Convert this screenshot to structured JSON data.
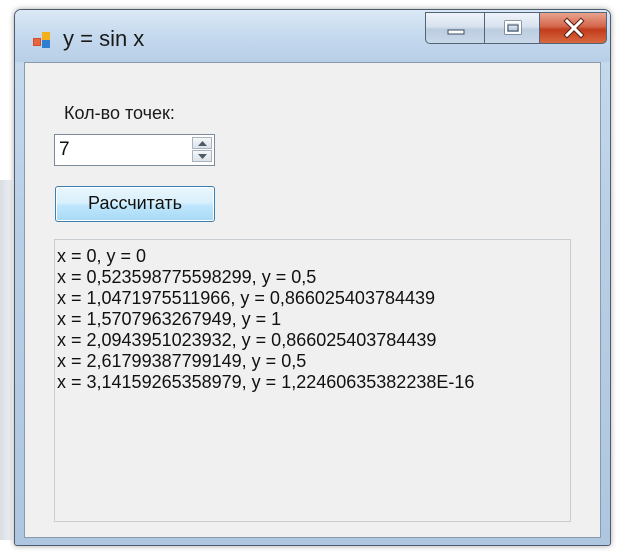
{
  "window": {
    "title": "y = sin x"
  },
  "form": {
    "count_label": "Кол-во точек:",
    "count_value": "7",
    "calculate_label": "Рассчитать"
  },
  "output": {
    "lines": [
      "x = 0, y = 0",
      "x = 0,523598775598299, y = 0,5",
      "x = 1,0471975511966, y = 0,866025403784439",
      "x = 1,5707963267949, y = 1",
      "x = 2,0943951023932, y = 0,866025403784439",
      "x = 2,61799387799149, y = 0,5",
      "x = 3,14159265358979, y = 1,22460635382238E-16"
    ]
  },
  "icons": {
    "app": "app-window-icon",
    "minimize": "minimize-icon",
    "maximize": "maximize-icon",
    "close": "close-icon",
    "spin_up": "chevron-up-icon",
    "spin_down": "chevron-down-icon"
  },
  "colors": {
    "close_button": "#c8432a",
    "title_bar": "#c5d9ee",
    "client_bg": "#f0f0f0",
    "button_accent": "#a7d9f5"
  }
}
